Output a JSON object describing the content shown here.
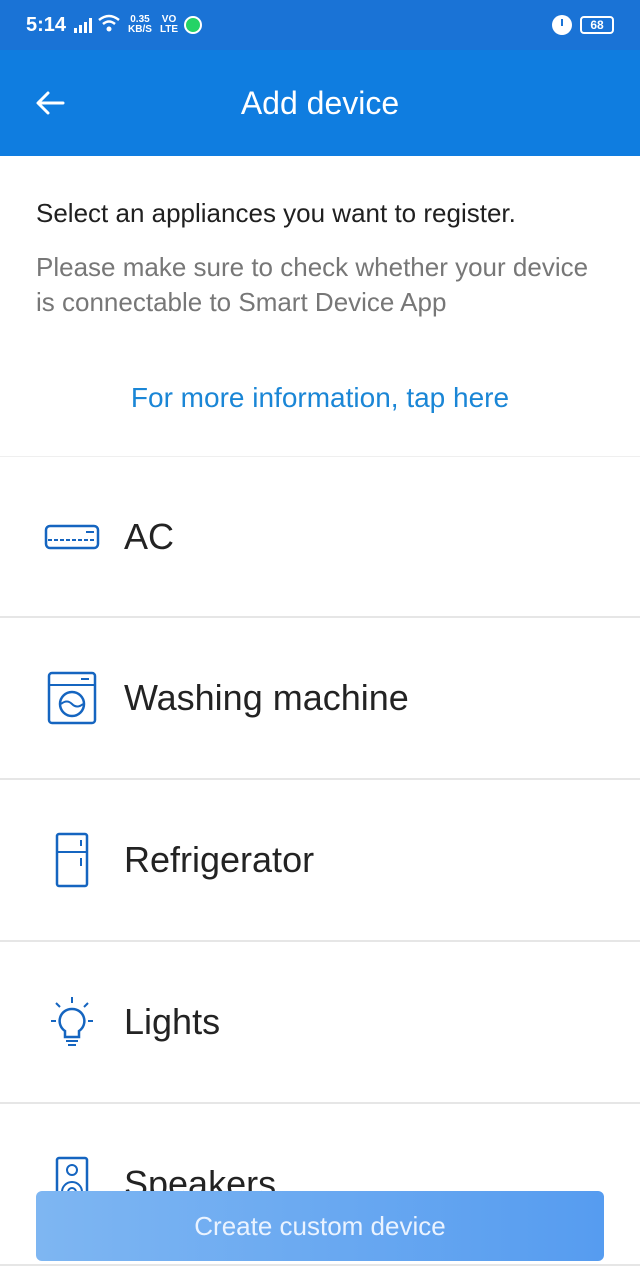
{
  "status_bar": {
    "time": "5:14",
    "speed_value": "0.35",
    "speed_unit": "KB/S",
    "volte_top": "VO",
    "volte_bottom": "LTE",
    "battery": "68"
  },
  "app_bar": {
    "title": "Add device",
    "color": "#0f7de0"
  },
  "intro": {
    "heading": "Select an appliances you want to register.",
    "text": "Please make sure to check whether your device is connectable to Smart Device App",
    "link": "For more information, tap here"
  },
  "devices": [
    {
      "label": "AC",
      "icon": "ac-icon"
    },
    {
      "label": "Washing machine",
      "icon": "washing-machine-icon"
    },
    {
      "label": "Refrigerator",
      "icon": "refrigerator-icon"
    },
    {
      "label": "Lights",
      "icon": "light-bulb-icon"
    },
    {
      "label": "Speakers",
      "icon": "speaker-icon"
    }
  ],
  "custom_button": {
    "label": "Create custom device"
  },
  "colors": {
    "accent": "#1a86d6",
    "icon": "#1565c0"
  }
}
